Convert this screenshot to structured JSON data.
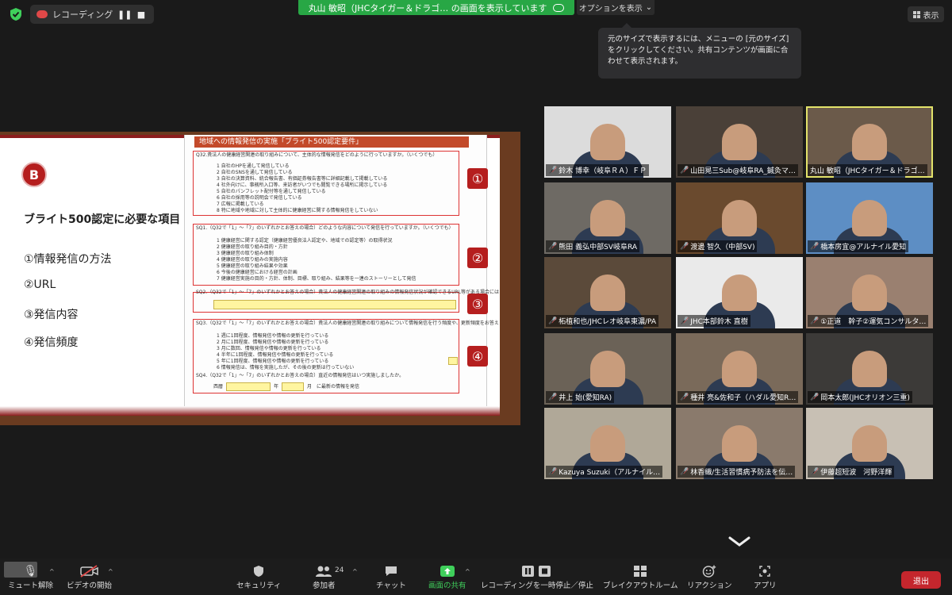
{
  "recording": {
    "label": "レコーディング..."
  },
  "share_banner": {
    "text": "丸山 敏昭（JHCタイガー＆ドラゴ… の画面を表示しています",
    "options_label": "オプションを表示"
  },
  "view_button": {
    "label": "表示"
  },
  "tooltip": {
    "text": "元のサイズで表示するには、メニューの [元のサイズ] をクリックしてください。共有コンテンツが画面に合わせて表示されます。"
  },
  "slide": {
    "badge": "B",
    "heading": "ブライト500認定に必要な項目",
    "items": [
      "①情報発信の方法",
      "②URL",
      "③発信内容",
      "④発信頻度"
    ],
    "doc_title": "地域への情報発信の実施「ブライト500認定要件」",
    "q32": "Q32.貴法人の健康経営関連の取り組みについて、主体的な情報発信をどのように行っていますか。（いくつでも）",
    "q32_options": [
      "1 自社のHPを通して発信している",
      "2 自社のSNSを通して発信している",
      "3 自社の決算資料、統合報告書、有価証券報告書等に詳細記載して掲載している",
      "4 社外向けに、事務所入口等、来訪者がいつでも閲覧できる場所に掲示している",
      "5 自社のパンフレット配付等を通して発信している",
      "6 自社の採用等の説明会で発信している",
      "7 広報に掲載している",
      "8 特に地域や地域に対して主体的に健康経営に関する情報発信をしていない"
    ],
    "sq1": "SQ1.（Q32で「1」～「7」のいずれかとお答えの場合）どのような内容について発信を行っていますか。（いくつでも）",
    "sq1_options": [
      "1 健康経営に関する認定（健康経営優良法人認定や、地域での認定等）の取得状況",
      "2 健康経営の取り組み目的・方針",
      "3 健康経営の取り組み体制",
      "4 健康経営の取り組みの実施内容",
      "5 健康経営の取り組み結果や効果",
      "6 今後の健康経営における経営の計画",
      "7 健康経営実施の目的・方針、体制、目標、取り組み、結果等を一連のストーリーとして発信"
    ],
    "sq2": "SQ2.（Q32で「1」～「7」のいずれかとお答えの場合）貴法人の健康経営関連の取り組みの情報発信状況が確認できるURL等がある場合にはご記入ください。",
    "sq3": "SQ3.（Q32で「1」～「7」のいずれかとお答えの場合）貴法人の健康経営関連の取り組みについて情報発信を行う頻度や、更新頻度をお答えください。（最も頻度が高いものについて1つだけ）",
    "sq3_options": [
      "1 週に1回程度、情報発信や情報の更新を行っている",
      "2 月に1回程度、情報発信や情報の更新を行っている",
      "3 月に数回、情報発信や情報の更新を行っている",
      "4 半年に1回程度、情報発信や情報の更新を行っている",
      "5 年に1回程度、情報発信や情報の更新を行っている",
      "6 情報発信は、情報を実施したが、その後の更新は行っていない"
    ],
    "sq4": "SQ4.（Q32で「1」～「7」のいずれかとお答えの場合）直近の情報発信はいつ実施しましたか。",
    "sq4_fields": {
      "era": "西暦",
      "year": "年",
      "month": "月",
      "suffix": "に最新の情報を発信"
    },
    "markers": [
      "①",
      "②",
      "③",
      "④"
    ]
  },
  "participants": [
    {
      "name": "鈴木 博幸（岐阜ＲＡ）ＦＰ",
      "muted": true,
      "bg": "#dcdcdc"
    },
    {
      "name": "山田晃三Sub@岐阜RA_鍼灸マ…",
      "muted": true,
      "bg": "#4a4038"
    },
    {
      "name": "丸山 敏昭（JHCタイガー＆ドラゴ…",
      "muted": false,
      "bg": "#6b5a4a",
      "active": true
    },
    {
      "name": "熊田 義弘中部SV岐阜RA",
      "muted": true,
      "bg": "#6e6a64"
    },
    {
      "name": "渡邊 智久（中部SV)",
      "muted": true,
      "bg": "#6a4a2e"
    },
    {
      "name": "橋本房宜@アルナイル愛知",
      "muted": true,
      "bg": "#5d8ec4"
    },
    {
      "name": "柘植和也/JHCレオ岐阜東濃/PA",
      "muted": true,
      "bg": "#5b4a3a"
    },
    {
      "name": "JHC本部鈴木 直樹",
      "muted": true,
      "bg": "#eaeaea"
    },
    {
      "name": "①正道　幹子②運気コンサルタ…",
      "muted": true,
      "bg": "#9a8070"
    },
    {
      "name": "井上 始(愛知RA)",
      "muted": true,
      "bg": "#6b6257"
    },
    {
      "name": "種井 亮&佐和子（ハダル愛知R…",
      "muted": true,
      "bg": "#7a6a5a"
    },
    {
      "name": "岡本太郎(JHCオリオン三重)",
      "muted": true,
      "bg": "#3c3a38"
    },
    {
      "name": "Kazuya Suzuki（アルナイル…",
      "muted": true,
      "bg": "#b0a898"
    },
    {
      "name": "林香織/生活習慣病予防法を伝…",
      "muted": true,
      "bg": "#8a7a6c"
    },
    {
      "name": "伊藤超短波　河野洋輝",
      "muted": true,
      "bg": "#c8c0b4"
    }
  ],
  "toolbar": {
    "mute": "ミュート解除",
    "video": "ビデオの開始",
    "security": "セキュリティ",
    "participants": "参加者",
    "participants_count": "24",
    "chat": "チャット",
    "share": "画面の共有",
    "record": "レコーディングを一時停止／停止",
    "breakout": "ブレイクアウトルーム",
    "reactions": "リアクション",
    "apps": "アプリ",
    "leave": "退出"
  },
  "colors": {
    "share_green": "#28a745",
    "leave_red": "#c4262d",
    "active_outline": "#e3e36a"
  }
}
